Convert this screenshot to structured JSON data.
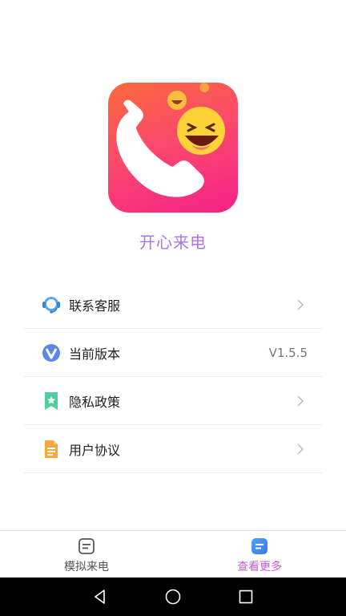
{
  "app": {
    "name": "开心来电"
  },
  "menu": {
    "items": [
      {
        "label": "联系客服",
        "icon": "customer-service-icon",
        "value": ""
      },
      {
        "label": "当前版本",
        "icon": "version-icon",
        "value": "V1.5.5"
      },
      {
        "label": "隐私政策",
        "icon": "privacy-icon",
        "value": ""
      },
      {
        "label": "用户协议",
        "icon": "agreement-icon",
        "value": ""
      }
    ]
  },
  "tabbar": {
    "tabs": [
      {
        "label": "模拟来电",
        "icon": "simulate-call-icon",
        "active": false
      },
      {
        "label": "查看更多",
        "icon": "more-icon",
        "active": true
      }
    ]
  },
  "colors": {
    "accent": "#c85cd6",
    "app_name": "#a875e8",
    "logo_gradient_start": "#fb6a3c",
    "logo_gradient_end": "#f5218a"
  }
}
